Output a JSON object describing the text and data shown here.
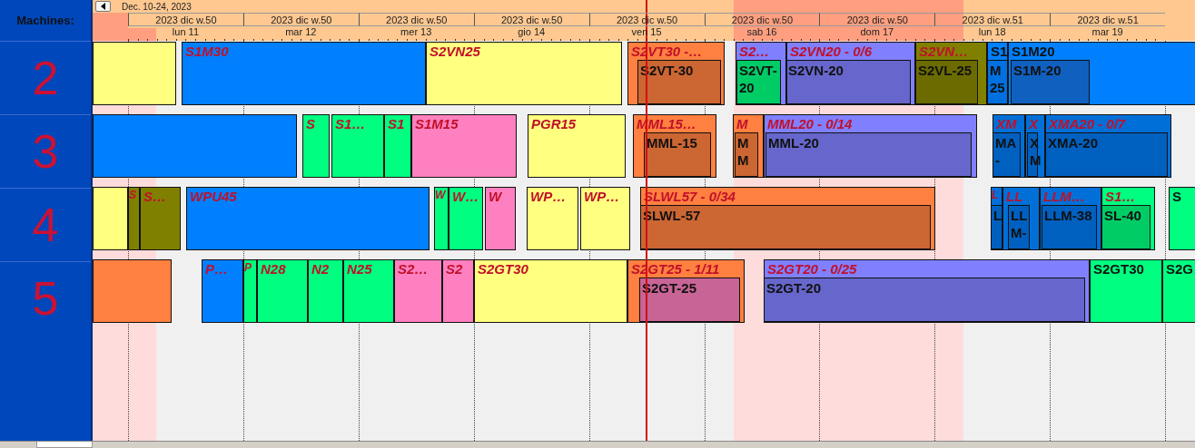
{
  "machines_header": "Machines:",
  "header": {
    "range": "Dec. 10-24, 2023",
    "days": [
      {
        "week": "2023 dic w.50",
        "day": "lun 11"
      },
      {
        "week": "2023 dic w.50",
        "day": "mar 12"
      },
      {
        "week": "2023 dic w.50",
        "day": "mer 13"
      },
      {
        "week": "2023 dic w.50",
        "day": "gio 14"
      },
      {
        "week": "2023 dic w.50",
        "day": "ven 15"
      },
      {
        "week": "2023 dic w.50",
        "day": "sab 16"
      },
      {
        "week": "2023 dic w.50",
        "day": "dom 17"
      },
      {
        "week": "2023 dic w.51",
        "day": "lun 18"
      },
      {
        "week": "2023 dic w.51",
        "day": "mar 19"
      }
    ]
  },
  "machines": [
    {
      "name": "2",
      "tasks": [
        {
          "color": "#ffff80"
        },
        {
          "title": "S1M30",
          "kind": "order",
          "color": "#0080ff"
        },
        {
          "title": "S2VN25",
          "kind": "order",
          "color": "#ffff80"
        },
        {
          "title": "S2VT30 -…",
          "kind": "order",
          "color": "#ff8040",
          "sub": {
            "label": "S2VT-30",
            "color": "#cc6633"
          }
        },
        {
          "title": "S2…",
          "kind": "order",
          "color": "#8080ff",
          "sub": {
            "label": "S2VT-20",
            "color": "#00cc66"
          }
        },
        {
          "title": "S2VN20 - 0/6",
          "kind": "order",
          "color": "#8080ff",
          "sub": {
            "label": "S2VN-20",
            "color": "#6666cc"
          }
        },
        {
          "title": "S2VN…",
          "kind": "order",
          "color": "#808000",
          "sub": {
            "label": "S2VL-25",
            "color": "#6b6b00"
          }
        },
        {
          "title": "S1",
          "kind": "running",
          "color": "#0080ff",
          "sub": {
            "label": "M 25",
            "color": "#0070e0"
          }
        },
        {
          "title": "S1M20",
          "kind": "running",
          "color": "#0080ff",
          "sub": {
            "label": "S1M-20",
            "color": "#1060c0"
          }
        }
      ]
    },
    {
      "name": "3",
      "tasks": [
        {
          "color": "#0080ff"
        },
        {
          "title": "S",
          "kind": "order",
          "color": "#00ff80"
        },
        {
          "title": "S1…",
          "kind": "order",
          "color": "#00ff80"
        },
        {
          "title": "S1",
          "kind": "order",
          "color": "#00ff80"
        },
        {
          "title": "S1M15",
          "kind": "order",
          "color": "#ff80c0"
        },
        {
          "title": "PGR15",
          "kind": "order",
          "color": "#ffff80"
        },
        {
          "title": "MML15…",
          "kind": "order",
          "color": "#ff8040",
          "sub": {
            "label": "MML-15",
            "color": "#cc6633"
          }
        },
        {
          "title": "M",
          "kind": "order",
          "color": "#ff8040",
          "sub": {
            "label": "MM",
            "color": "#cc6633"
          }
        },
        {
          "title": "MML20 - 0/14",
          "kind": "order",
          "color": "#8080ff",
          "sub": {
            "label": "MML-20",
            "color": "#6666cc"
          }
        },
        {
          "title": "XM",
          "kind": "order",
          "color": "#0070d8",
          "sub": {
            "label": "MA-",
            "color": "#0060c0"
          }
        },
        {
          "title": "X",
          "kind": "order",
          "color": "#0070d8",
          "sub": {
            "label": "XM",
            "color": "#0060c0"
          }
        },
        {
          "title": "XMA20 - 0/7",
          "kind": "order",
          "color": "#0070d8",
          "sub": {
            "label": "XMA-20",
            "color": "#0060c0"
          }
        }
      ]
    },
    {
      "name": "4",
      "tasks": [
        {
          "color": "#ffff80"
        },
        {
          "title": "S",
          "kind": "order",
          "color": "#808000"
        },
        {
          "title": "S…",
          "kind": "order",
          "color": "#808000"
        },
        {
          "title": "WPU45",
          "kind": "order",
          "color": "#0080ff"
        },
        {
          "title": "W",
          "kind": "order",
          "color": "#00ff80"
        },
        {
          "title": "W…",
          "kind": "order",
          "color": "#00ff80"
        },
        {
          "title": "W",
          "kind": "order",
          "color": "#ff80c0"
        },
        {
          "title": "WP…",
          "kind": "order",
          "color": "#ffff80"
        },
        {
          "title": "WP…",
          "kind": "order",
          "color": "#ffff80"
        },
        {
          "title": "SLWL57 - 0/34",
          "kind": "order",
          "color": "#ff8040",
          "sub": {
            "label": "SLWL-57",
            "color": "#cc6633"
          }
        },
        {
          "title": "L",
          "kind": "order",
          "color": "#0070d8",
          "sub": {
            "label": "L",
            "color": "#0060c0"
          }
        },
        {
          "title": "LL",
          "kind": "order",
          "color": "#0070d8",
          "sub": {
            "label": "LLM-",
            "color": "#0060c0"
          }
        },
        {
          "title": "LLM…",
          "kind": "order",
          "color": "#0070d8",
          "sub": {
            "label": "LLM-38",
            "color": "#0060c0"
          }
        },
        {
          "title": "S1…",
          "kind": "order",
          "color": "#00ff80",
          "sub": {
            "label": "SL-40",
            "color": "#00cc66"
          }
        },
        {
          "title": "S",
          "kind": "running",
          "color": "#00ff80"
        }
      ]
    },
    {
      "name": "5",
      "tasks": [
        {
          "color": "#ff8040"
        },
        {
          "title": "P…",
          "kind": "order",
          "color": "#0080ff"
        },
        {
          "title": "P",
          "kind": "order",
          "color": "#00ff80"
        },
        {
          "title": "N28",
          "kind": "order",
          "color": "#00ff80"
        },
        {
          "title": "N2",
          "kind": "order",
          "color": "#00ff80"
        },
        {
          "title": "N25",
          "kind": "order",
          "color": "#00ff80"
        },
        {
          "title": "S2…",
          "kind": "order",
          "color": "#ff80c0"
        },
        {
          "title": "S2",
          "kind": "order",
          "color": "#ff80c0"
        },
        {
          "title": "S2GT30",
          "kind": "order",
          "color": "#ffff80"
        },
        {
          "title": "S2GT25 - 1/11",
          "kind": "order",
          "color": "#ff8040",
          "sub": {
            "label": "S2GT-25",
            "color": "#c86496"
          }
        },
        {
          "title": "S2GT20 - 0/25",
          "kind": "order",
          "color": "#8080ff",
          "sub": {
            "label": "S2GT-20",
            "color": "#6666cc"
          }
        },
        {
          "title": "S2GT30",
          "kind": "running",
          "color": "#00ff80"
        },
        {
          "title": "S2G",
          "kind": "running",
          "color": "#00ff80"
        }
      ]
    }
  ]
}
